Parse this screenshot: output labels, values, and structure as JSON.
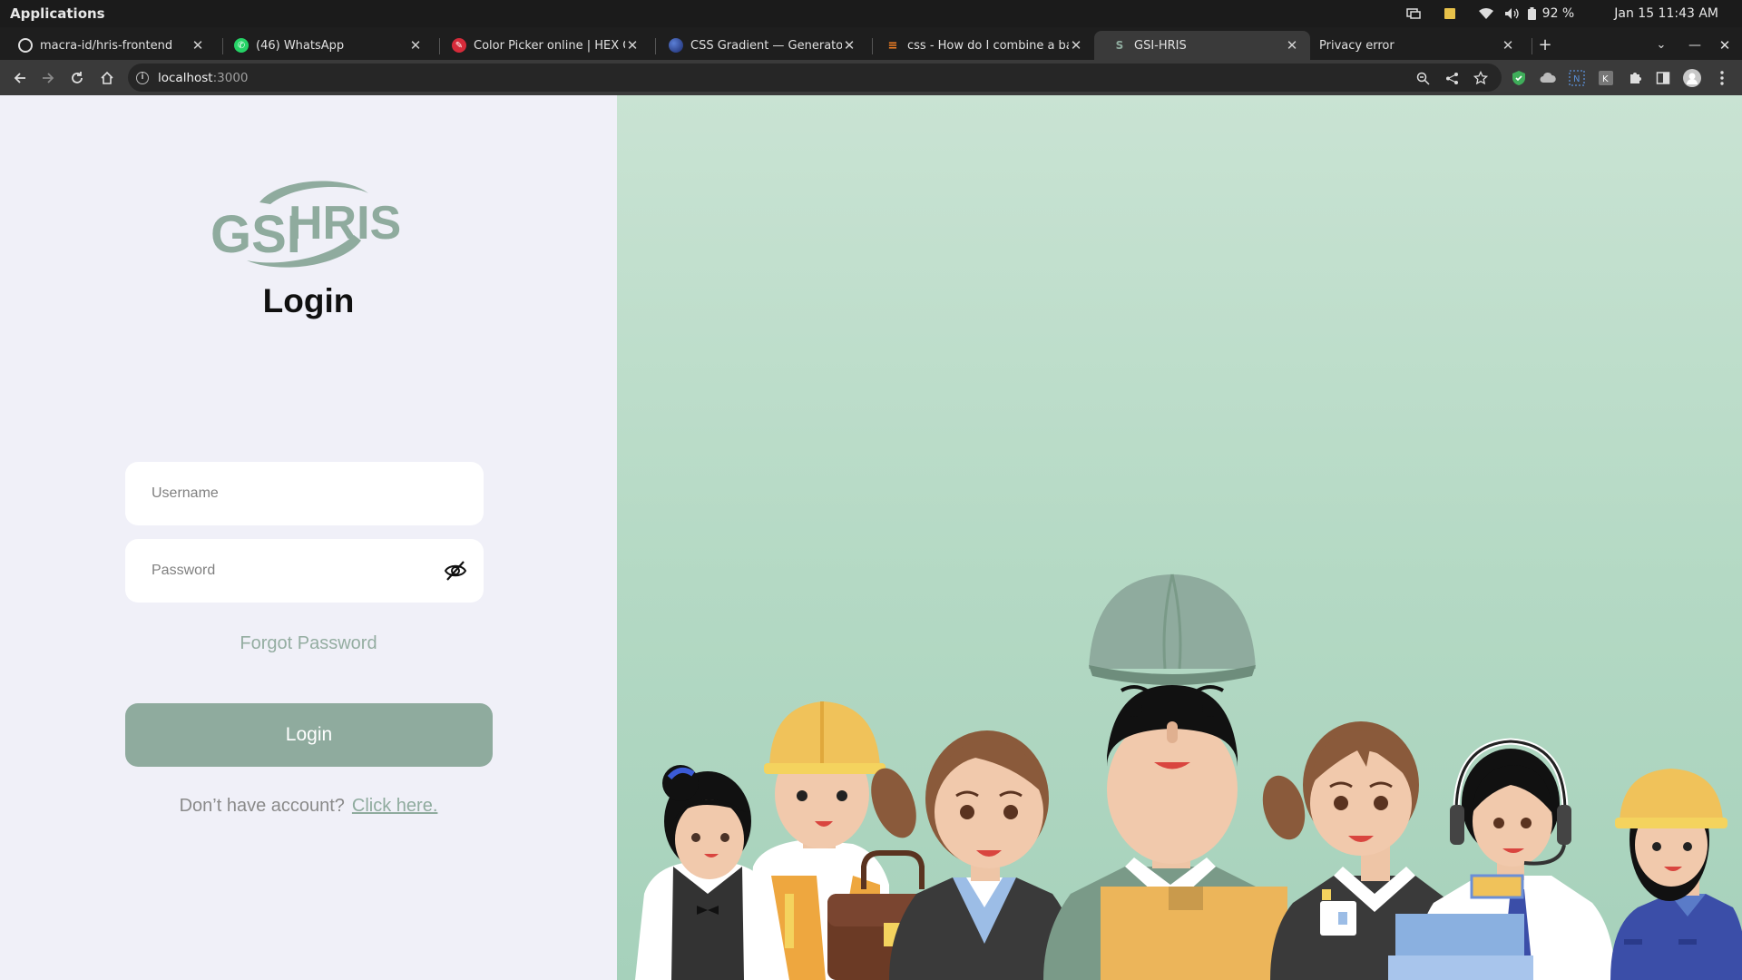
{
  "os": {
    "apps_label": "Applications",
    "battery": "92 %",
    "datetime": "Jan 15  11:43 AM",
    "icons": [
      "screen-icon",
      "note-icon",
      "wifi-icon",
      "volume-icon",
      "battery-icon"
    ]
  },
  "tabs": [
    {
      "title": "macra-id/hris-frontend",
      "icon": "github-icon",
      "active": false
    },
    {
      "title": "(46) WhatsApp",
      "icon": "whatsapp-icon",
      "active": false
    },
    {
      "title": "Color Picker online | HEX C",
      "icon": "color-picker-icon",
      "active": false
    },
    {
      "title": "CSS Gradient — Generator, Ma",
      "icon": "css-gradient-icon",
      "active": false
    },
    {
      "title": "css - How do I combine a bac",
      "icon": "stackoverflow-icon",
      "active": false
    },
    {
      "title": "GSI-HRIS",
      "icon": "gsi-hris-icon",
      "active": true
    },
    {
      "title": "Privacy error",
      "icon": "",
      "active": false
    }
  ],
  "toolbar": {
    "url_host": "localhost",
    "url_port": ":3000"
  },
  "login": {
    "logo_text_left": "GSI",
    "logo_text_right": "HRIS",
    "title": "Login",
    "username_placeholder": "Username",
    "password_placeholder": "Password",
    "forgot_label": "Forgot Password",
    "button_label": "Login",
    "signup_prompt": "Don’t have account?",
    "signup_link": "Click here."
  },
  "colors": {
    "accent": "#8fab9e",
    "page_bg": "#f0f0f8",
    "hero_bg": "#b4d9c4"
  }
}
